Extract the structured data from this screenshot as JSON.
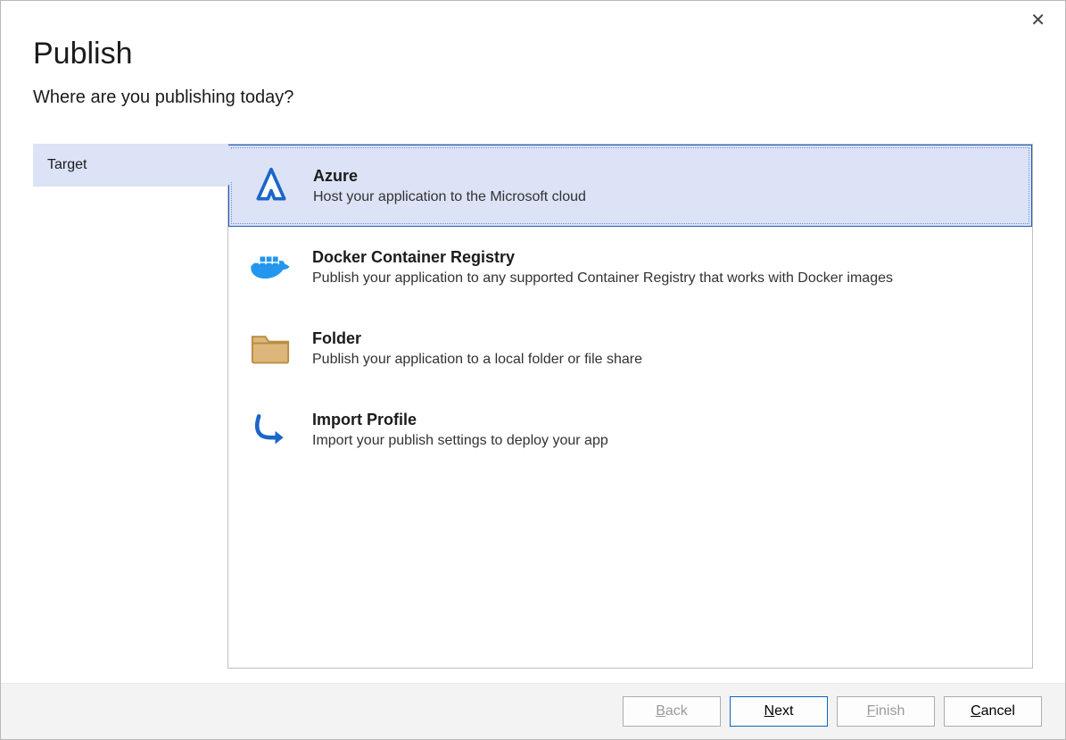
{
  "window": {
    "close_label": "✕"
  },
  "header": {
    "title": "Publish",
    "subtitle": "Where are you publishing today?"
  },
  "steps": {
    "items": [
      {
        "label": "Target",
        "active": true
      }
    ]
  },
  "options": [
    {
      "id": "azure",
      "title": "Azure",
      "description": "Host your application to the Microsoft cloud",
      "selected": true,
      "icon": "azure-icon"
    },
    {
      "id": "docker",
      "title": "Docker Container Registry",
      "description": "Publish your application to any supported Container Registry that works with Docker images",
      "selected": false,
      "icon": "docker-icon"
    },
    {
      "id": "folder",
      "title": "Folder",
      "description": "Publish your application to a local folder or file share",
      "selected": false,
      "icon": "folder-icon"
    },
    {
      "id": "import",
      "title": "Import Profile",
      "description": "Import your publish settings to deploy your app",
      "selected": false,
      "icon": "import-arrow-icon"
    }
  ],
  "footer": {
    "back": {
      "label": "Back",
      "accel": "B",
      "enabled": false
    },
    "next": {
      "label": "Next",
      "accel": "N",
      "enabled": true
    },
    "finish": {
      "label": "Finish",
      "accel": "F",
      "enabled": false
    },
    "cancel": {
      "label": "Cancel",
      "accel": "C",
      "enabled": true
    }
  },
  "colors": {
    "accent_bg": "#dce3f7",
    "accent_border": "#1e5bbd",
    "docker_blue": "#2396ed",
    "folder_fill": "#dcb67a",
    "folder_stroke": "#b88b3d"
  }
}
